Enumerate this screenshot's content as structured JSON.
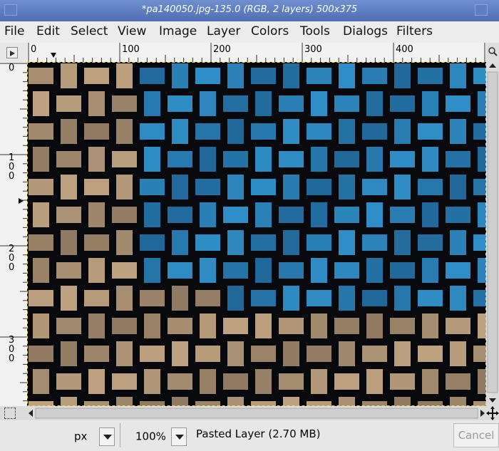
{
  "window": {
    "title": "*pa140050.jpg-135.0 (RGB, 2 layers) 500x375"
  },
  "menubar": {
    "items": [
      "File",
      "Edit",
      "Select",
      "View",
      "Image",
      "Layer",
      "Colors",
      "Tools",
      "Dialogs",
      "Filters"
    ]
  },
  "rulers": {
    "horizontal_labels": [
      "0",
      "100",
      "200",
      "300",
      "400"
    ],
    "vertical_labels": [
      "0",
      "100",
      "200",
      "300"
    ]
  },
  "canvas": {
    "description_colors": {
      "blue": "#2c7fb4",
      "sand": "#b9a488",
      "shadow": "#0a0d12"
    }
  },
  "statusbar": {
    "unit": "px",
    "zoom": "100%",
    "message": "Pasted Layer (2.70 MB)",
    "cancel_label": "Cancel"
  },
  "icons": {
    "navigate": "navigate-icon",
    "quickmask": "quick-mask-icon",
    "zoom": "zoom-icon"
  }
}
